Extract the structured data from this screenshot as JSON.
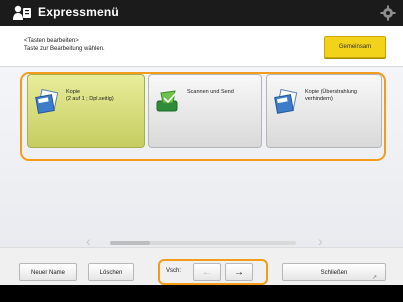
{
  "title": "Expressmenü",
  "instructions": [
    "<Tasten bearbeiten>",
    "Taste zur Bearbeitung wählen."
  ],
  "shared_button": "Gemeinsam",
  "tiles": [
    {
      "line1": "Kopie",
      "line2": "(2 auf 1 ; Dpl.seitig)",
      "icon": "copy-icon",
      "selected": true
    },
    {
      "line1": "Scannen und Send",
      "line2": "",
      "icon": "scan-send-icon",
      "selected": false
    },
    {
      "line1": "Kopie (Überstrahlung",
      "line2": "verhindern)",
      "icon": "copy-icon",
      "selected": false
    }
  ],
  "toolbar": {
    "rename_label": "Neuer Name",
    "delete_label": "Löschen",
    "move_label": "Vsch:",
    "left_arrow": "←",
    "right_arrow": "→",
    "close_label": "Schließen"
  },
  "colors": {
    "accent": "#f39c1c",
    "selected_tile": "#d7dd7b",
    "title_bar": "#1b1b1b"
  }
}
